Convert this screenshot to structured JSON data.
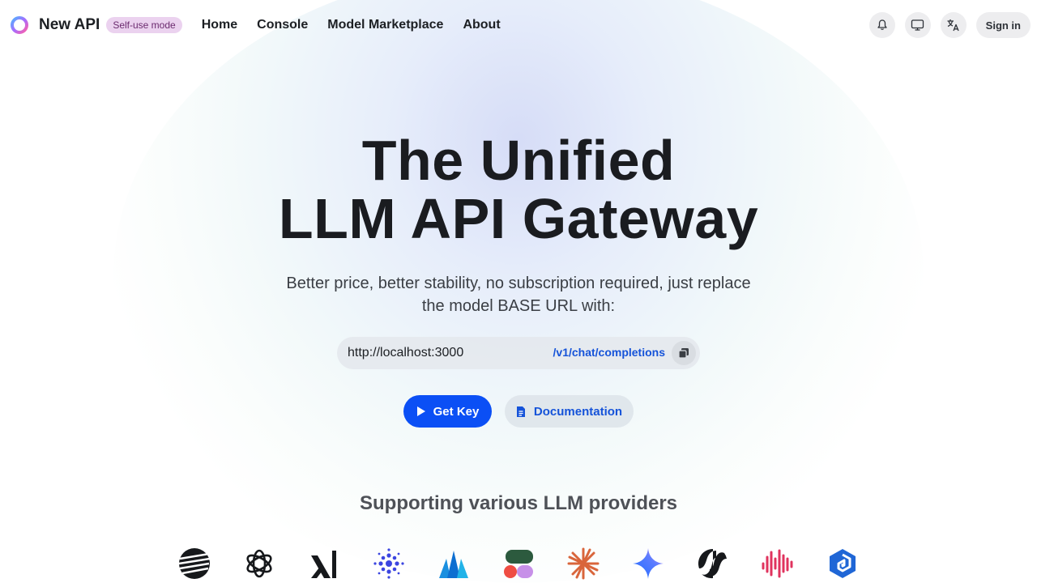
{
  "header": {
    "brand": "New API",
    "badge": "Self-use mode",
    "nav": [
      "Home",
      "Console",
      "Model Marketplace",
      "About"
    ],
    "signin_label": "Sign in"
  },
  "hero": {
    "title_line1": "The Unified",
    "title_line2": "LLM API Gateway",
    "subtitle": "Better price, better stability, no subscription required, just replace the model BASE URL with:",
    "base_url": "http://localhost:3000",
    "endpoint": "/v1/chat/completions",
    "get_key_label": "Get Key",
    "docs_label": "Documentation"
  },
  "providers": {
    "title": "Supporting various LLM providers",
    "icons": [
      "moonshot-icon",
      "openai-icon",
      "xai-icon",
      "zhipu-icon",
      "mistral-icon",
      "poe-icon",
      "claude-icon",
      "gemini-icon",
      "stepfun-icon",
      "minimax-icon",
      "deepseek-icon"
    ]
  },
  "colors": {
    "accent": "#0b4ff5",
    "link": "#1553d9",
    "badge_bg": "#ebd2ef"
  }
}
